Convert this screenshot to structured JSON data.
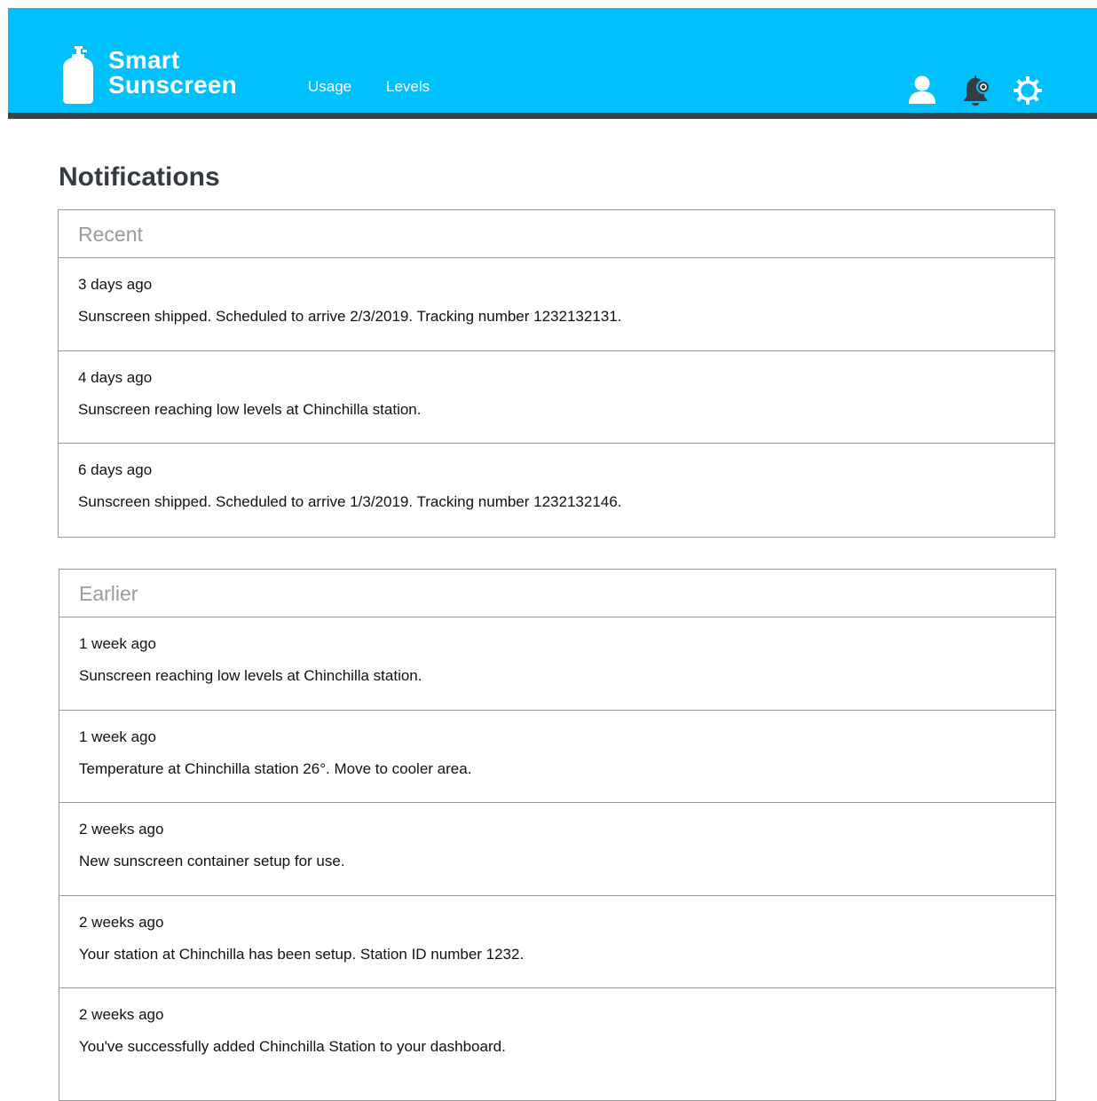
{
  "app": {
    "brand_line1": "Smart",
    "brand_line2": "Sunscreen",
    "accent_color": "#00c1fb",
    "rule_color": "#3a4249"
  },
  "nav": {
    "items": [
      {
        "label": "Usage"
      },
      {
        "label": "Levels"
      }
    ]
  },
  "header_icons": [
    "user-icon",
    "notification-bell-icon",
    "settings-gear-icon"
  ],
  "page": {
    "title": "Notifications"
  },
  "sections": [
    {
      "title": "Recent",
      "items": [
        {
          "time": "3 days ago",
          "message": "Sunscreen shipped. Scheduled to arrive 2/3/2019. Tracking number 1232132131."
        },
        {
          "time": "4 days ago",
          "message": "Sunscreen reaching low levels at Chinchilla station."
        },
        {
          "time": "6 days ago",
          "message": "Sunscreen shipped. Scheduled to arrive 1/3/2019. Tracking number 1232132146."
        }
      ]
    },
    {
      "title": "Earlier",
      "items": [
        {
          "time": "1 week ago",
          "message": "Sunscreen reaching low levels at Chinchilla station."
        },
        {
          "time": "1 week ago",
          "message": "Temperature at Chinchilla station 26°. Move to cooler area."
        },
        {
          "time": "2 weeks ago",
          "message": "New sunscreen container setup for use."
        },
        {
          "time": "2 weeks ago",
          "message": "Your station at Chinchilla has been setup. Station ID number 1232."
        },
        {
          "time": "2 weeks ago",
          "message": "You've successfully added Chinchilla Station to your dashboard."
        }
      ]
    }
  ]
}
